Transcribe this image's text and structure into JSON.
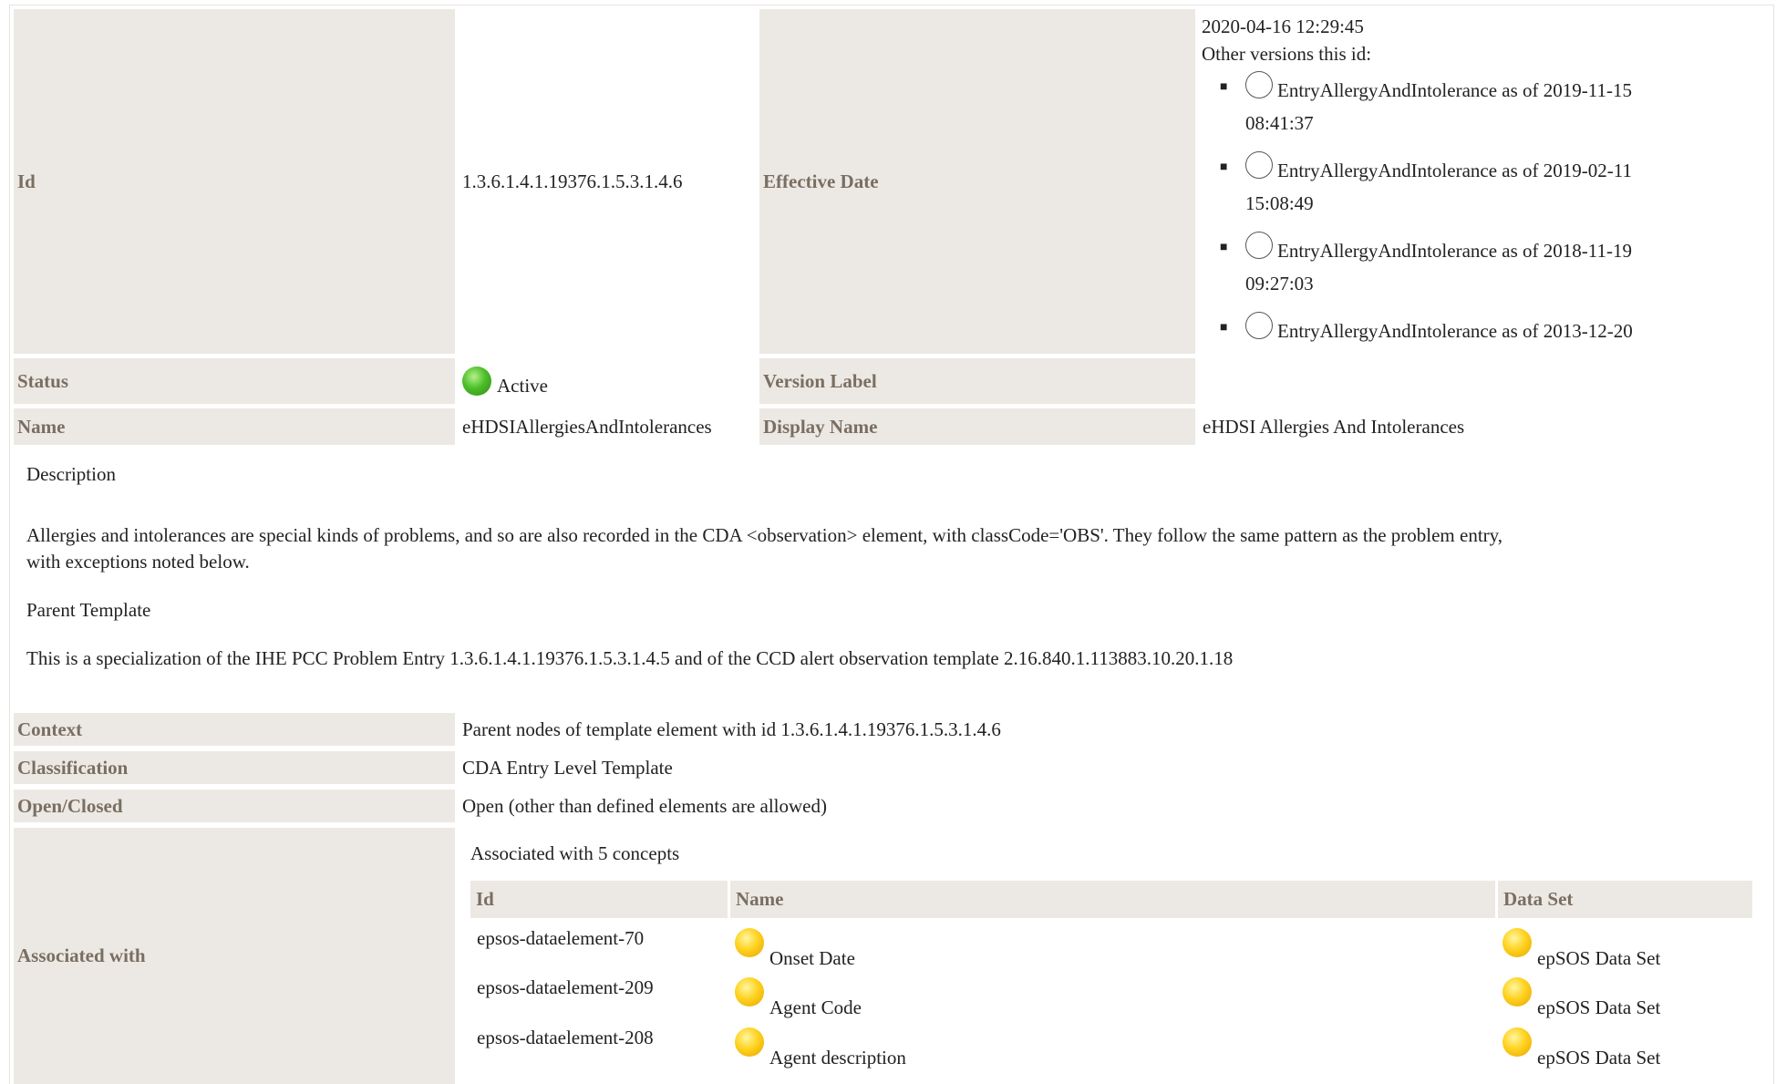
{
  "header": {
    "id_label": "Id",
    "id_value": "1.3.6.1.4.1.19376.1.5.3.1.4.6",
    "effective_date_label": "Effective Date",
    "effective_date_value": "2020-04-16 12:29:45",
    "other_versions_label": "Other versions this id:",
    "other_versions": [
      {
        "line1": "EntryAllergyAndIntolerance as of 2019-11-15",
        "line2": "08:41:37"
      },
      {
        "line1": "EntryAllergyAndIntolerance as of 2019-02-11",
        "line2": "15:08:49"
      },
      {
        "line1": "EntryAllergyAndIntolerance as of 2018-11-19",
        "line2": "09:27:03"
      },
      {
        "line1": "EntryAllergyAndIntolerance as of 2013-12-20",
        "line2": ""
      }
    ],
    "status_label": "Status",
    "status_value": "Active",
    "version_label_label": "Version Label",
    "name_label": "Name",
    "name_value": "eHDSIAllergiesAndIntolerances",
    "display_name_label": "Display Name",
    "display_name_value": "eHDSI Allergies And Intolerances"
  },
  "description": {
    "heading": "Description",
    "text_line1": "Allergies and intolerances are special kinds of problems, and so are also recorded in the CDA <observation> element, with classCode='OBS'. They follow the same pattern as the problem entry,",
    "text_line2": "with exceptions noted below.",
    "parent_heading": "Parent Template",
    "parent_text": "This is a specialization of the IHE PCC Problem Entry 1.3.6.1.4.1.19376.1.5.3.1.4.5 and of the CCD alert observation template 2.16.840.1.113883.10.20.1.18"
  },
  "details": {
    "context_label": "Context",
    "context_value": "Parent nodes of template element with id 1.3.6.1.4.1.19376.1.5.3.1.4.6",
    "classification_label": "Classification",
    "classification_value": "CDA Entry Level Template",
    "open_closed_label": "Open/Closed",
    "open_closed_value": "Open (other than defined elements are allowed)",
    "associated_label": "Associated with",
    "associated_summary": "Associated with 5 concepts"
  },
  "concepts": {
    "columns": [
      "Id",
      "Name",
      "Data Set"
    ],
    "rows": [
      {
        "id": "epsos-dataelement-70",
        "name": "Onset Date",
        "dataset": "epSOS Data Set"
      },
      {
        "id": "epsos-dataelement-209",
        "name": "Agent Code",
        "dataset": "epSOS Data Set"
      },
      {
        "id": "epsos-dataelement-208",
        "name": "Agent description",
        "dataset": "epSOS Data Set"
      }
    ]
  },
  "colors": {
    "label_bg": "#ece9e4",
    "label_text": "#7a6e62",
    "status_active": "#4dbf2a",
    "concept_dot": "#ffd21f"
  },
  "icons": {
    "status": "green-status-dot-icon",
    "version_radio": "radio-circle-icon",
    "concept": "yellow-concept-dot-icon"
  }
}
